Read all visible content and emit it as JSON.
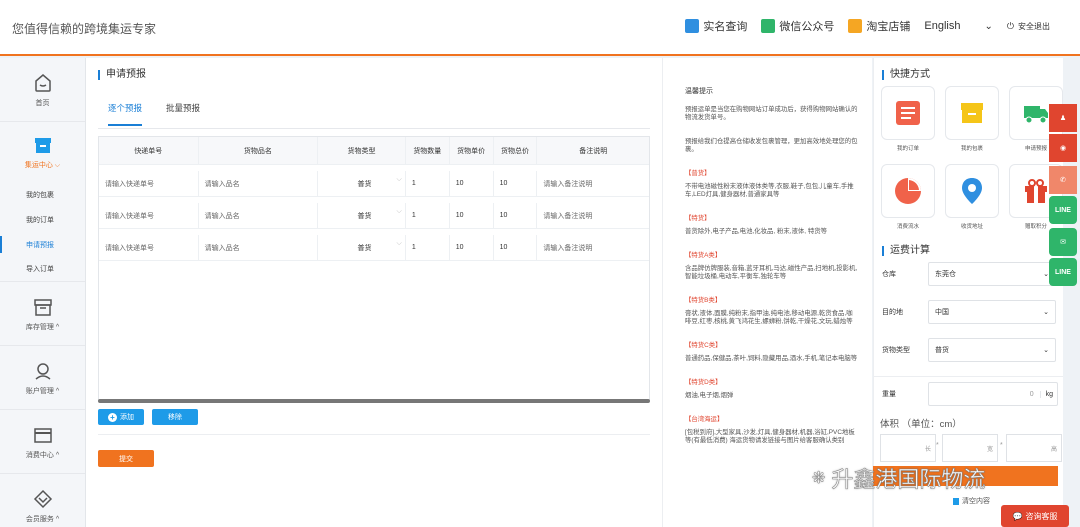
{
  "header": {
    "slogan": "您值得信赖的跨境集运专家",
    "links": [
      "实名查询",
      "微信公众号",
      "淘宝店铺"
    ],
    "language": "English",
    "logout": "安全退出",
    "colors": {
      "accent": "#f0731f",
      "link": "#1a7fd6"
    }
  },
  "sidebar": {
    "items": [
      {
        "label": "首页",
        "icon": "home-icon"
      },
      {
        "label": "集运中心",
        "icon": "package-box-icon"
      },
      {
        "label": "库存管理",
        "icon": "inventory-box-icon"
      },
      {
        "label": "账户管理",
        "icon": "user-account-icon"
      },
      {
        "label": "消费中心",
        "icon": "wallet-card-icon"
      },
      {
        "label": "会员服务",
        "icon": "diamond-vip-icon"
      }
    ],
    "sub_items": [
      "我的包裹",
      "我的订单",
      "申请预报",
      "导入订单"
    ]
  },
  "forecast": {
    "title": "申请预报",
    "tabs": [
      "逐个预报",
      "批量预报"
    ],
    "columns": [
      "快递单号",
      "货物品名",
      "货物类型",
      "货物数量",
      "货物单价",
      "货物总价",
      "备注说明"
    ],
    "rows": [
      [
        "请输入快递单号",
        "请输入品名",
        "普货",
        "1",
        "10",
        "10",
        "请输入备注说明"
      ],
      [
        "请输入快递单号",
        "请输入品名",
        "普货",
        "1",
        "10",
        "10",
        "请输入备注说明"
      ],
      [
        "请输入快递单号",
        "请输入品名",
        "普货",
        "1",
        "10",
        "10",
        "请输入备注说明"
      ]
    ],
    "add_label": "添加",
    "remove_label": "移除",
    "submit_label": "提交"
  },
  "notice": {
    "title": "温馨提示",
    "p1": "预报运单是当您在购物网站订单成功后，获得购物网站确认的物流发货单号。",
    "p2": "预报给我们仓提高仓储收发包裹管理，更加高效地处理您的包裹。",
    "sections": [
      {
        "head": "【普货】",
        "body": "不带电池磁性粉末液体液体类等,衣服,鞋子,包包,儿童车,手推车,LED灯具,健身器材,普通家具等"
      },
      {
        "head": "【特货】",
        "body": "普货除外,电子产品,电池,化妆品, 粉末,液体, 特货等"
      },
      {
        "head": "【特货A类】",
        "body": "含品牌仿牌服装,音箱,蓝牙耳机,马达,磁性产品,扫地机,投影机,智能垃圾桶,电动车,平衡车,独轮车等"
      },
      {
        "head": "【特货B类】",
        "body": "膏状,液体,面膜,纯粉末,指甲油,纯电池,移动电源,乾货食品,咖啡豆,红枣,核桃,黄飞鸿花生,螺蛳粉,饼乾,干燥花,文玩,蜡烛等"
      },
      {
        "head": "【特货C类】",
        "body": "普通药品,保健品,茶叶,饲料,隐藏用品,酒水,手机,笔记本电脑等"
      },
      {
        "head": "【特货D类】",
        "body": "烟油,电子烟,烟弹"
      },
      {
        "head": "【台湾海运】",
        "body": "[包税到府],大型家具,沙发,灯具,健身器材,机器,浴缸,PVC地板等(有最低消费) 海运货物请发链接与图片给客服确认类别"
      }
    ]
  },
  "quick": {
    "title": "快捷方式",
    "items": [
      {
        "label": "我的订单",
        "icon": "order-list-icon",
        "color": "#f0624a"
      },
      {
        "label": "我的包裹",
        "icon": "package-icon",
        "color": "#f5c518"
      },
      {
        "label": "申请预报",
        "icon": "delivery-truck-icon",
        "color": "#2fb56a"
      },
      {
        "label": "消费流水",
        "icon": "pie-chart-icon",
        "color": "#f0624a"
      },
      {
        "label": "收货地址",
        "icon": "location-pin-icon",
        "color": "#2f8fe0"
      },
      {
        "label": "赠取积分",
        "icon": "gift-icon",
        "color": "#e0452f"
      }
    ]
  },
  "calc": {
    "title": "运费计算",
    "warehouse_label": "仓库",
    "warehouse_value": "东莞仓",
    "dest_label": "目的地",
    "dest_value": "中国",
    "type_label": "货物类型",
    "type_value": "普货",
    "weight_label": "重量",
    "weight_value": "0",
    "weight_unit": "kg",
    "volume_label": "体积 （单位：cm）",
    "length_ph": "长",
    "width_ph": "宽",
    "height_ph": "高",
    "clear_label": "清空内容"
  },
  "float": {
    "consult_label": "咨询客服",
    "line1": "LINE",
    "line2": "LINE"
  },
  "watermark": "升鑫港国际物流"
}
